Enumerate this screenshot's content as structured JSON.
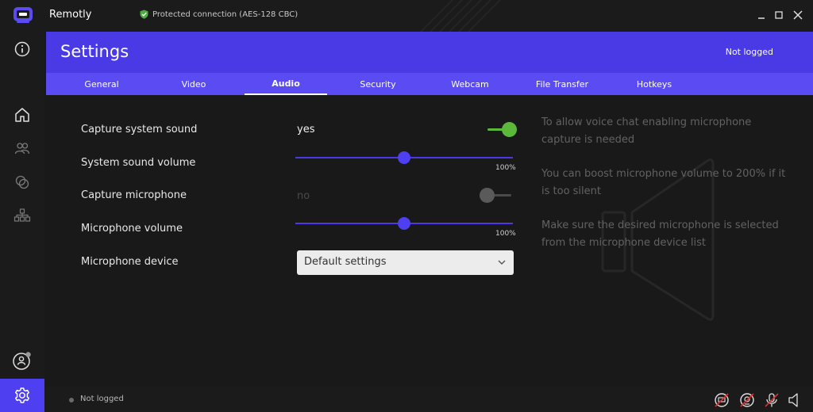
{
  "app": {
    "title": "Remotly",
    "connection_status": "Protected connection (AES-128 CBC)",
    "icons": [
      "app-logo",
      "shield-check-icon",
      "minimize-icon",
      "maximize-icon",
      "close-icon"
    ]
  },
  "sidebar": {
    "items": [
      {
        "name": "info",
        "icon": "info-icon"
      },
      {
        "name": "home",
        "icon": "home-icon"
      },
      {
        "name": "contacts",
        "icon": "users-icon"
      },
      {
        "name": "sessions",
        "icon": "overlap-circles-icon"
      },
      {
        "name": "network",
        "icon": "network-icon"
      },
      {
        "name": "account",
        "icon": "user-circle-icon"
      },
      {
        "name": "settings",
        "icon": "gear-icon",
        "active": true
      }
    ]
  },
  "header": {
    "title": "Settings",
    "login_status": "Not logged"
  },
  "tabs": [
    {
      "label": "General"
    },
    {
      "label": "Video"
    },
    {
      "label": "Audio",
      "active": true
    },
    {
      "label": "Security"
    },
    {
      "label": "Webcam"
    },
    {
      "label": "File Transfer"
    },
    {
      "label": "Hotkeys"
    }
  ],
  "audio": {
    "capture_system_sound": {
      "label": "Capture system sound",
      "value_text": "yes",
      "enabled": true
    },
    "system_sound_volume": {
      "label": "System sound volume",
      "percent_text": "100%",
      "level": 0.5
    },
    "capture_microphone": {
      "label": "Capture microphone",
      "value_text": "no",
      "enabled": false
    },
    "microphone_volume": {
      "label": "Microphone volume",
      "percent_text": "100%",
      "level": 0.5
    },
    "microphone_device": {
      "label": "Microphone device",
      "value": "Default settings"
    }
  },
  "info": {
    "line1": "To allow voice chat enabling microphone capture is needed",
    "line2": "You can boost microphone volume to 200% if it is too silent",
    "line3": "Make sure the desired microphone is selected from the microphone device list"
  },
  "statusbar": {
    "status_text": "Not logged",
    "icons": [
      "screen-off-icon",
      "webcam-off-icon",
      "microphone-off-icon",
      "speaker-icon"
    ]
  },
  "colors": {
    "accent": "#4a3ae6",
    "tab_bar": "#5b4bf3",
    "toggle_on": "#5cb83a",
    "toggle_off": "#5a5a5a",
    "background": "#191919"
  }
}
